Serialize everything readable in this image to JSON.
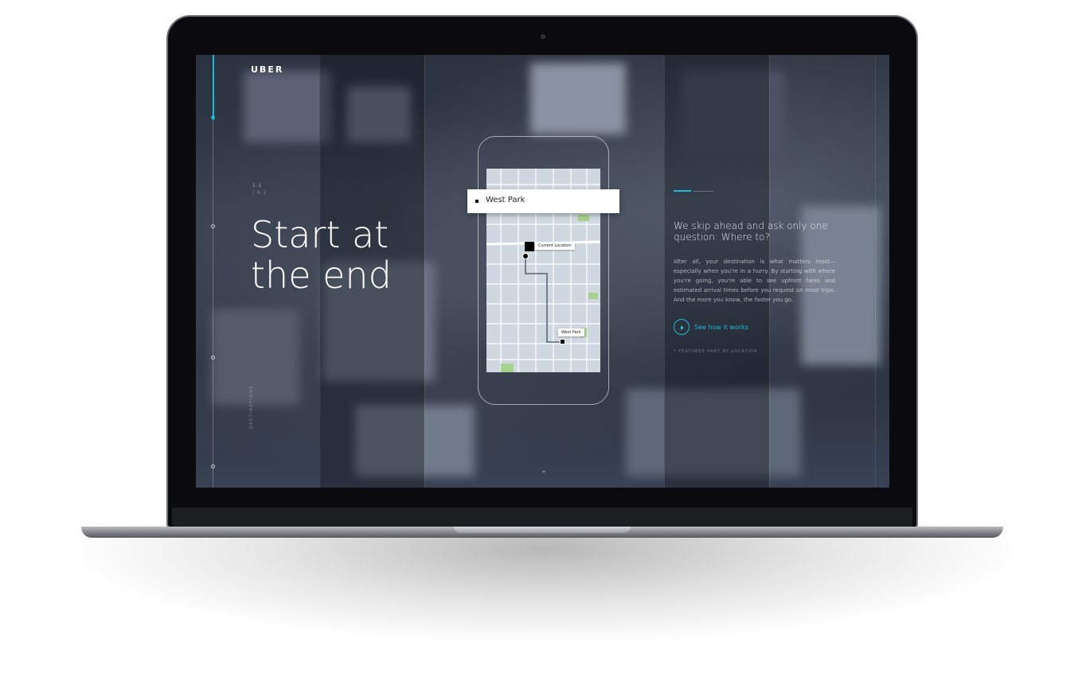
{
  "brand": {
    "logo_text": "UBER",
    "accent_color": "#1fbad6"
  },
  "progress": {
    "counter_current": "1.1",
    "counter_total": "/ 6.2",
    "section_label": "DESTINATIONS",
    "active_fraction": 0.15
  },
  "hero": {
    "headline": "Start at the end"
  },
  "phone_mock": {
    "search_value": "West Park",
    "current_location_label": "Current Location",
    "destination_label": "West Park",
    "car_badge": "uber"
  },
  "detail": {
    "subhead": "We skip ahead and ask only one question: Where to?",
    "body": "After all, your destination is what matters most—especially when you're in a hurry. By starting with where you're going, you're able to see upfront fares and estimated arrival times before you request on most trips. And the more you know, the faster you go.",
    "cta_label": "See how it works",
    "footnote": "* FEATURES VARY BY LOCATION"
  },
  "icons": {
    "play": "play-icon",
    "chevron": "chevron-down-icon",
    "search_square": "square-marker-icon"
  }
}
